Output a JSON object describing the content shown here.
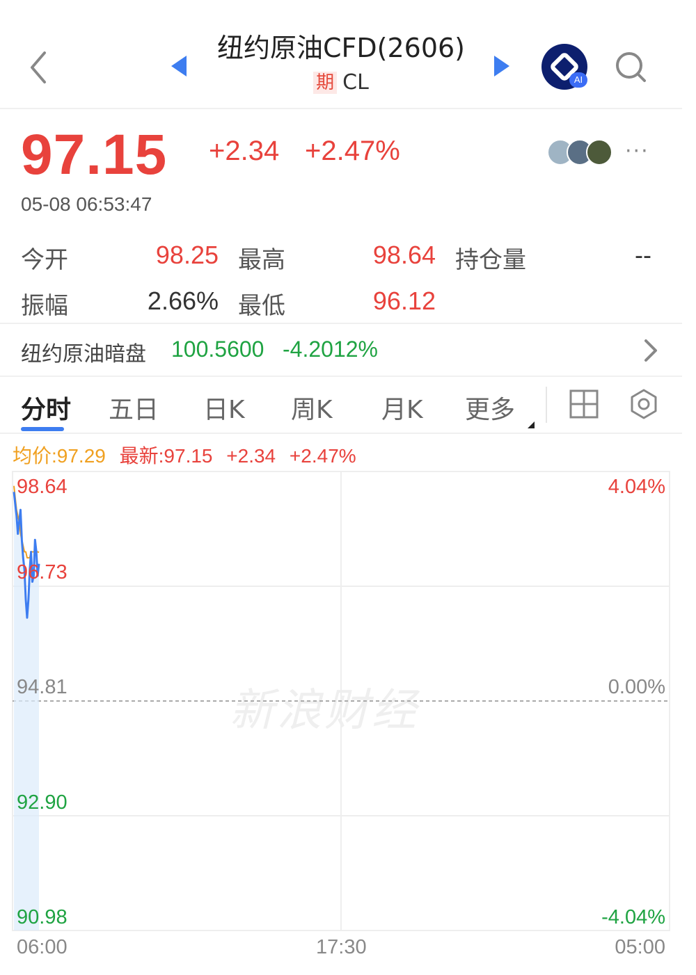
{
  "header": {
    "title": "纽约原油CFD(2606)",
    "futures_tag": "期",
    "symbol": "CL",
    "ai_badge": "AI",
    "icons": [
      "back-arrow-icon",
      "prev-triangle-icon",
      "next-triangle-icon",
      "ai-assistant-icon",
      "search-icon"
    ]
  },
  "quote": {
    "price": "97.15",
    "change": "+2.34",
    "change_pct": "+2.47%",
    "timestamp": "05-08 06:53:47",
    "more": "···"
  },
  "stats": {
    "open_label": "今开",
    "open_value": "98.25",
    "high_label": "最高",
    "high_value": "98.64",
    "oi_label": "持仓量",
    "oi_value": "--",
    "amp_label": "振幅",
    "amp_value": "2.66%",
    "low_label": "最低",
    "low_value": "96.12"
  },
  "dark_pool": {
    "label": "纽约原油暗盘",
    "price": "100.5600",
    "pct": "-4.2012%"
  },
  "tabs": [
    "分时",
    "五日",
    "日K",
    "周K",
    "月K",
    "更多"
  ],
  "legend": {
    "avg": "均价:97.29",
    "latest": "最新:97.15",
    "change": "+2.34",
    "pct": "+2.47%"
  },
  "colors": {
    "up": "#e8423c",
    "down": "#1fa342",
    "avg_line": "#f0a020",
    "price_line": "#3d7df0",
    "accent": "#3d7df0"
  },
  "chart_data": {
    "type": "line",
    "y_left_ticks": [
      "98.64",
      "96.73",
      "94.81",
      "92.90",
      "90.98"
    ],
    "y_right_ticks": [
      "4.04%",
      "",
      "0.00%",
      "",
      "-4.04%"
    ],
    "x_ticks": [
      "06:00",
      "17:30",
      "05:00"
    ],
    "ylim": [
      90.98,
      98.64
    ],
    "reference_price": 94.81,
    "series": [
      {
        "values": [
          98.3,
          98.1,
          97.9,
          97.6,
          97.8,
          98.0,
          97.5,
          97.2,
          97.0,
          96.5,
          96.2,
          96.5,
          97.0,
          97.3,
          96.8,
          96.9,
          97.5,
          97.3,
          96.9,
          97.1
        ]
      },
      {
        "values": [
          98.4,
          98.2,
          98.0,
          97.9,
          97.8,
          97.6,
          97.5,
          97.4,
          97.3,
          97.3,
          97.2,
          97.2,
          97.2,
          97.3,
          97.3,
          97.3,
          97.3,
          97.3,
          97.3,
          97.29
        ]
      }
    ]
  }
}
